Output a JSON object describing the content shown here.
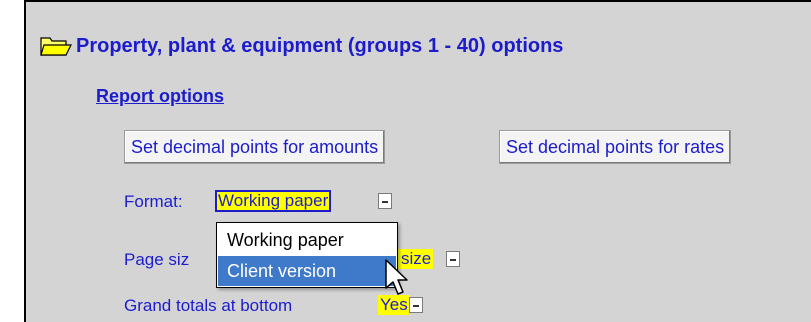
{
  "header": {
    "title": "Property, plant & equipment (groups 1 - 40) options"
  },
  "report_options_link": "Report options",
  "buttons": {
    "amounts": "Set decimal points for amounts",
    "rates": "Set decimal points for rates"
  },
  "format": {
    "label": "Format:",
    "value": "Working paper"
  },
  "page_size": {
    "label_visible": "Page siz",
    "value_visible": "size"
  },
  "grand_totals": {
    "label": "Grand totals at bottom",
    "value": "Yes"
  },
  "dropdown": {
    "options": [
      {
        "label": "Working paper",
        "selected": false
      },
      {
        "label": "Client version",
        "selected": true
      }
    ]
  },
  "colors": {
    "panel": "#d4d4d4",
    "link": "#1c1ccc",
    "highlight": "#ffff00",
    "selection": "#3f79c9"
  },
  "icons": [
    "folder-open-icon",
    "dropdown-arrow-icon",
    "mouse-pointer-icon"
  ]
}
